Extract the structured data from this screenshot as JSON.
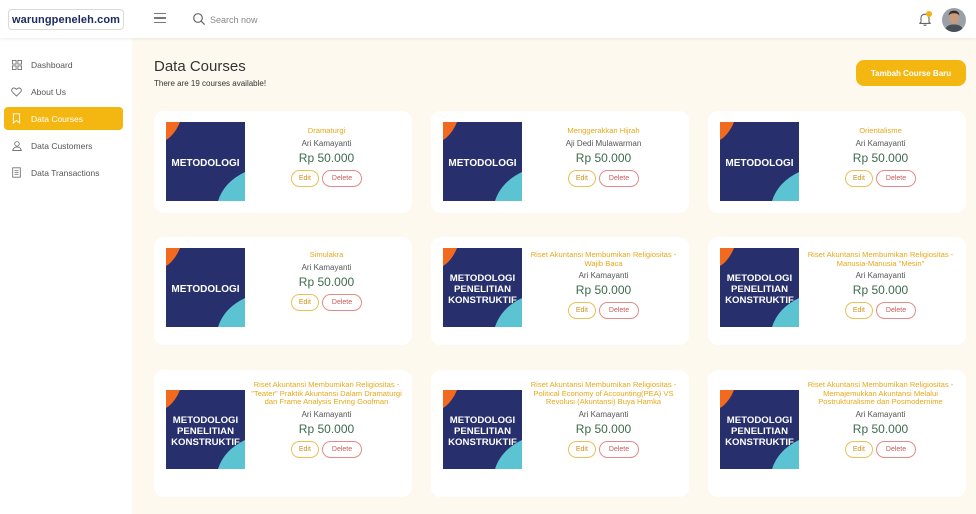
{
  "header": {
    "logo": "warungpeneleh.com",
    "search_placeholder": "Search now"
  },
  "sidebar": {
    "items": [
      {
        "label": "Dashboard",
        "icon": "grid-icon",
        "active": false
      },
      {
        "label": "About Us",
        "icon": "heart-icon",
        "active": false
      },
      {
        "label": "Data Courses",
        "icon": "bookmark-icon",
        "active": true
      },
      {
        "label": "Data Customers",
        "icon": "user-icon",
        "active": false
      },
      {
        "label": "Data Transactions",
        "icon": "document-icon",
        "active": false
      }
    ]
  },
  "main": {
    "title": "Data Courses",
    "subtitle": "There are 19 courses available!",
    "add_button": "Tambah Course Baru",
    "edit_label": "Edit",
    "delete_label": "Delete"
  },
  "courses": [
    {
      "title": "Dramaturgi",
      "author": "Ari Kamayanti",
      "price": "Rp 50.000",
      "thumb_lines": [
        "METODOLOGI"
      ]
    },
    {
      "title": "Menggerakkan Hijrah",
      "author": "Aji Dedi Mulawarman",
      "price": "Rp 50.000",
      "thumb_lines": [
        "METODOLOGI"
      ]
    },
    {
      "title": "Orientalisme",
      "author": "Ari Kamayanti",
      "price": "Rp 50.000",
      "thumb_lines": [
        "METODOLOGI"
      ]
    },
    {
      "title": "Simulakra",
      "author": "Ari Kamayanti",
      "price": "Rp 50.000",
      "thumb_lines": [
        "METODOLOGI"
      ]
    },
    {
      "title": "Riset Akuntansi Membumikan Religiositas - Wajib Baca",
      "author": "Ari Kamayanti",
      "price": "Rp 50.000",
      "thumb_lines": [
        "METODOLOGI",
        "PENELITIAN",
        "KONSTRUKTIF"
      ]
    },
    {
      "title": "Riset Akuntansi Membumikan Religiositas - Manusia-Manusia \"Mesin\"",
      "author": "Ari Kamayanti",
      "price": "Rp 50.000",
      "thumb_lines": [
        "METODOLOGI",
        "PENELITIAN",
        "KONSTRUKTIF"
      ]
    },
    {
      "title": "Riset Akuntansi Membumikan Religiositas - \"Teater\" Praktik Akuntansi Dalam Dramaturgi dan Frame Analysis Erving Goofman",
      "author": "Ari Kamayanti",
      "price": "Rp 50.000",
      "thumb_lines": [
        "METODOLOGI",
        "PENELITIAN",
        "KONSTRUKTIF"
      ]
    },
    {
      "title": "Riset Akuntansi Membumikan Religiositas - Political Economy of Accounting(PEA) VS Revolusi (Akuntansi) Buya Hamka",
      "author": "Ari Kamayanti",
      "price": "Rp 50.000",
      "thumb_lines": [
        "METODOLOGI",
        "PENELITIAN",
        "KONSTRUKTIF"
      ]
    },
    {
      "title": "Riset Akuntansi Membumikan Religiositas - Memajemukkan Akuntansi Melalui Postrukturalisme dan Posmodernime",
      "author": "Ari Kamayanti",
      "price": "Rp 50.000",
      "thumb_lines": [
        "METODOLOGI",
        "PENELITIAN",
        "KONSTRUKTIF"
      ]
    }
  ],
  "colors": {
    "accent": "#f4b610",
    "thumb_navy": "#27306c",
    "thumb_orange": "#f26a1f",
    "thumb_teal": "#5cc3d3",
    "price_green": "#3d6b4c"
  }
}
